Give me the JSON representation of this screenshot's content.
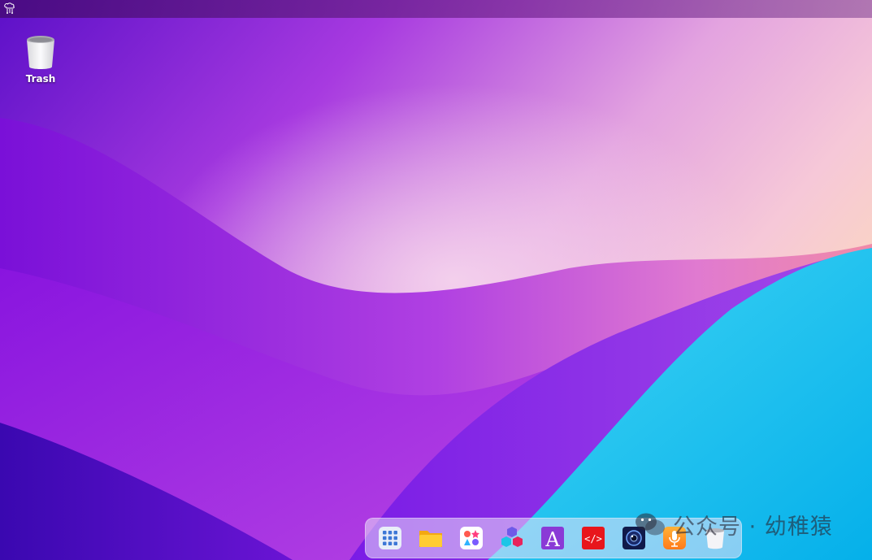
{
  "desktop": {
    "icons": [
      {
        "label": "Trash",
        "icon": "trash-icon"
      }
    ]
  },
  "dock": {
    "items": [
      {
        "name": "app-launcher",
        "icon": "grid-icon"
      },
      {
        "name": "file-manager",
        "icon": "folder-icon"
      },
      {
        "name": "app-store",
        "icon": "apps-icon"
      },
      {
        "name": "cubes-app",
        "icon": "cubes-icon"
      },
      {
        "name": "font-app",
        "icon": "font-a-icon"
      },
      {
        "name": "code-editor",
        "icon": "code-icon"
      },
      {
        "name": "camera-app",
        "icon": "camera-icon"
      },
      {
        "name": "voice-recorder",
        "icon": "microphone-icon"
      },
      {
        "name": "trash",
        "icon": "trash-icon"
      }
    ]
  },
  "watermark": {
    "text": "公众号 · 幼稚猿",
    "icon": "wechat-icon"
  },
  "colors": {
    "wallpaper_purple": "#8a1fe0",
    "wallpaper_pink": "#f2a6c8",
    "wallpaper_cyan": "#1fc6ee",
    "topbar": "#5a1a8c"
  }
}
